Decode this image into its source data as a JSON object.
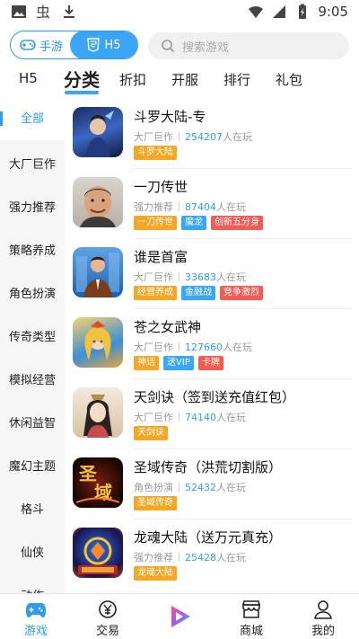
{
  "status_bar": {
    "time": "9:05"
  },
  "mode_switch": {
    "game_label": "手游",
    "h5_label": "H5"
  },
  "search": {
    "placeholder": "搜索游戏"
  },
  "tabs": [
    {
      "label": "H5"
    },
    {
      "label": "分类"
    },
    {
      "label": "折扣"
    },
    {
      "label": "开服"
    },
    {
      "label": "排行"
    },
    {
      "label": "礼包"
    }
  ],
  "sidebar": {
    "items": [
      {
        "label": "全部"
      },
      {
        "label": "大厂巨作"
      },
      {
        "label": "强力推荐"
      },
      {
        "label": "策略养成"
      },
      {
        "label": "角色扮演"
      },
      {
        "label": "传奇类型"
      },
      {
        "label": "模拟经营"
      },
      {
        "label": "休闲益智"
      },
      {
        "label": "魔幻主题"
      },
      {
        "label": "格斗"
      },
      {
        "label": "仙侠"
      },
      {
        "label": "动作"
      }
    ]
  },
  "games": [
    {
      "title": "斗罗大陆-专",
      "category": "大厂巨作",
      "players": "254207",
      "players_suffix": "人在玩",
      "tags": [
        {
          "text": "斗罗大陆",
          "color": "#f5a623"
        }
      ]
    },
    {
      "title": "一刀传世",
      "category": "强力推荐",
      "players": "87404",
      "players_suffix": "人在玩",
      "tags": [
        {
          "text": "一刀传世",
          "color": "#f5a623"
        },
        {
          "text": "魔龙",
          "color": "#3aa6f5"
        },
        {
          "text": "创新五分身",
          "color": "#f25c54"
        }
      ]
    },
    {
      "title": "谁是首富",
      "category": "大厂巨作",
      "players": "33683",
      "players_suffix": "人在玩",
      "tags": [
        {
          "text": "经营养成",
          "color": "#f5a623"
        },
        {
          "text": "金融战",
          "color": "#3aa6f5"
        },
        {
          "text": "竞争激烈",
          "color": "#f25c54"
        }
      ]
    },
    {
      "title": "苍之女武神",
      "category": "大厂巨作",
      "players": "127660",
      "players_suffix": "人在玩",
      "tags": [
        {
          "text": "神话",
          "color": "#f5a623"
        },
        {
          "text": "送VIP",
          "color": "#3aa6f5"
        },
        {
          "text": "卡牌",
          "color": "#f25c54"
        }
      ]
    },
    {
      "title": "天剑诀（签到送充值红包）",
      "category": "大厂巨作",
      "players": "74140",
      "players_suffix": "人在玩",
      "tags": [
        {
          "text": "天剑诀",
          "color": "#f5a623"
        }
      ]
    },
    {
      "title": "圣域传奇（洪荒切割版）",
      "category": "角色扮演",
      "players": "52432",
      "players_suffix": "人在玩",
      "tags": [
        {
          "text": "圣域传奇",
          "color": "#f5a623"
        }
      ]
    },
    {
      "title": "龙魂大陆（送万元真充）",
      "category": "强力推荐",
      "players": "25428",
      "players_suffix": "人在玩",
      "tags": [
        {
          "text": "龙魂大陆",
          "color": "#f5a623"
        }
      ]
    }
  ],
  "bottom_nav": [
    {
      "label": "游戏"
    },
    {
      "label": "交易"
    },
    {
      "label": ""
    },
    {
      "label": "商城"
    },
    {
      "label": "我的"
    }
  ],
  "colors": {
    "accent": "#2f9cf0",
    "tag_orange": "#f5a623",
    "tag_blue": "#3aa6f5",
    "tag_red": "#f25c54"
  }
}
